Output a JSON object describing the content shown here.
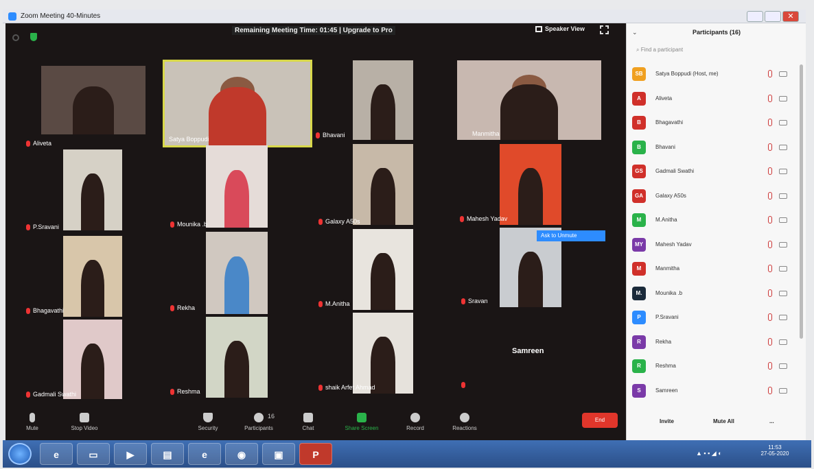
{
  "window": {
    "title": "Zoom Meeting 40-Minutes"
  },
  "meeting": {
    "timer": "Remaining Meeting Time: 01:45 | Upgrade to Pro",
    "speaker_view": "Speaker View",
    "ask_unmute": "Ask to Unmute",
    "tiles": [
      {
        "name": "Aliveta",
        "color": "#5a4a44"
      },
      {
        "name": "Satya Boppudi",
        "color": "#c9c2b8"
      },
      {
        "name": "Bhavani",
        "color": "#b8b0a6"
      },
      {
        "name": "Manmitha",
        "color": "#c8b8b0"
      },
      {
        "name": "P.Sravani",
        "color": "#d6d1c6"
      },
      {
        "name": "Mounika .b",
        "color": "#e5dcd8"
      },
      {
        "name": "Galaxy A50s",
        "color": "#c7b9a8"
      },
      {
        "name": "Mahesh Yadav",
        "color": "#e04a2a"
      },
      {
        "name": "Bhagavathi",
        "color": "#d8c6aa"
      },
      {
        "name": "Rekha",
        "color": "#d0c8c0"
      },
      {
        "name": "M.Anitha",
        "color": "#e8e4de"
      },
      {
        "name": "Sravan",
        "color": "#c9ccd0"
      },
      {
        "name": "Gadmali Swathi",
        "color": "#e0c9c9"
      },
      {
        "name": "Reshma",
        "color": "#d2d6c6"
      },
      {
        "name": "shaik Arfet Ahmad",
        "color": "#e6e2dc"
      },
      {
        "name": "Samreen",
        "color": ""
      }
    ],
    "toolbar": {
      "mute": "Mute",
      "stop_video": "Stop Video",
      "security": "Security",
      "participants": "Participants",
      "participants_count": "16",
      "chat": "Chat",
      "share_screen": "Share Screen",
      "record": "Record",
      "reactions": "Reactions",
      "end": "End"
    }
  },
  "panel": {
    "title": "Participants (16)",
    "search_placeholder": "Find a participant",
    "participants": [
      {
        "initials": "SB",
        "name": "Satya Boppudi (Host, me)",
        "color": "#f0a020"
      },
      {
        "initials": "A",
        "name": "Aliveta",
        "color": "#d0302a"
      },
      {
        "initials": "B",
        "name": "Bhagavathi",
        "color": "#d0302a"
      },
      {
        "initials": "B",
        "name": "Bhavani",
        "color": "#2ab24a"
      },
      {
        "initials": "GS",
        "name": "Gadmali Swathi",
        "color": "#d0302a"
      },
      {
        "initials": "GA",
        "name": "Galaxy A50s",
        "color": "#d0302a"
      },
      {
        "initials": "M",
        "name": "M.Anitha",
        "color": "#2ab24a"
      },
      {
        "initials": "MY",
        "name": "Mahesh Yadav",
        "color": "#7a3aa8"
      },
      {
        "initials": "M",
        "name": "Manmitha",
        "color": "#d0302a"
      },
      {
        "initials": "M.",
        "name": "Mounika .b",
        "color": "#1a2a3a"
      },
      {
        "initials": "P",
        "name": "P.Sravani",
        "color": "#2d8cff"
      },
      {
        "initials": "R",
        "name": "Rekha",
        "color": "#7a3aa8"
      },
      {
        "initials": "R",
        "name": "Reshma",
        "color": "#2ab24a"
      },
      {
        "initials": "S",
        "name": "Samreen",
        "color": "#7a3aa8"
      }
    ],
    "invite": "Invite",
    "mute_all": "Mute All",
    "more": "..."
  },
  "taskbar": {
    "time": "11:53",
    "date": "27-05-2020"
  }
}
